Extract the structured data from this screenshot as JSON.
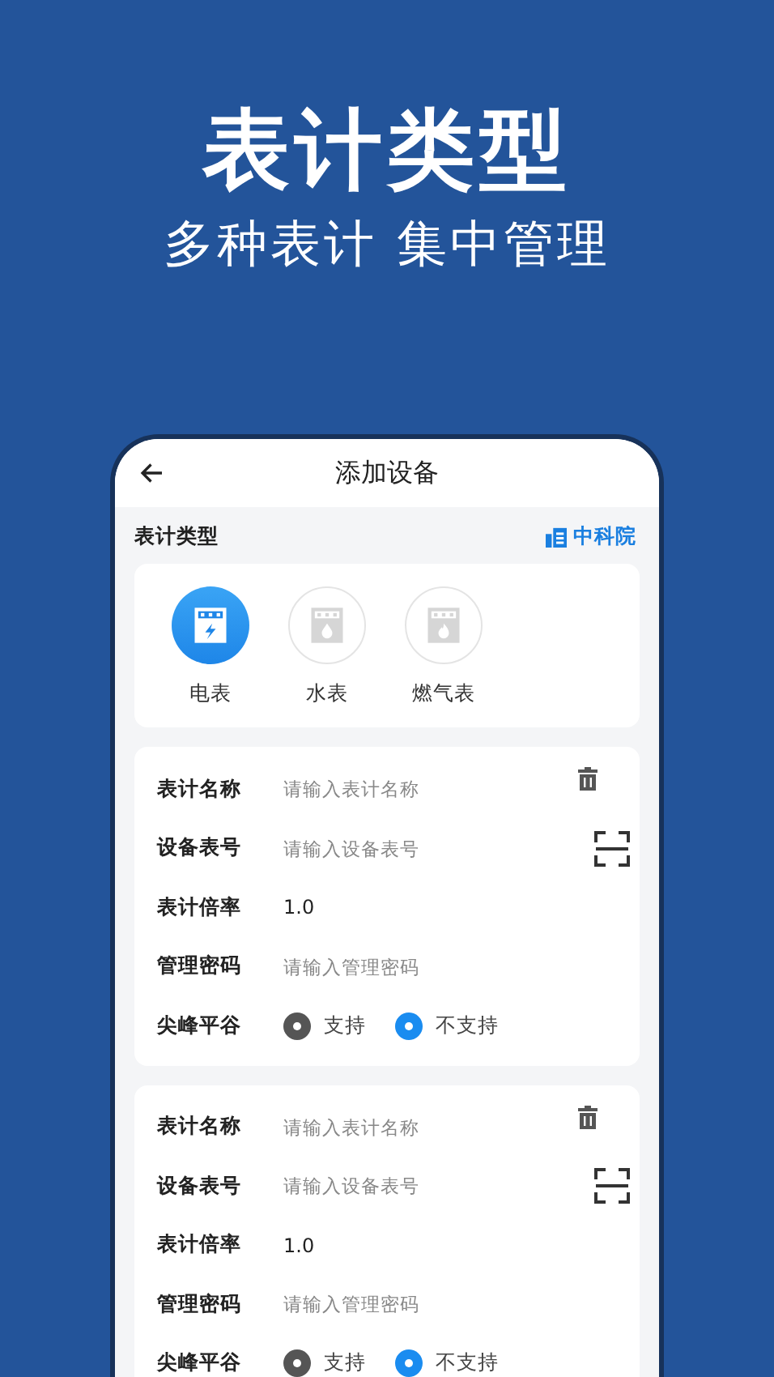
{
  "headline": "表计类型",
  "subheadline": "多种表计 集中管理",
  "app": {
    "title": "添加设备",
    "section_label": "表计类型",
    "org_link": "中科院",
    "meter_types": [
      {
        "label": "电表",
        "kind": "electric",
        "selected": true
      },
      {
        "label": "水表",
        "kind": "water",
        "selected": false
      },
      {
        "label": "燃气表",
        "kind": "gas",
        "selected": false
      }
    ],
    "meters": [
      {
        "fields": [
          {
            "kind": "input",
            "label": "表计名称",
            "placeholder": "请输入表计名称"
          },
          {
            "kind": "input",
            "label": "设备表号",
            "placeholder": "请输入设备表号",
            "scan": true
          },
          {
            "kind": "value",
            "label": "表计倍率",
            "value": "1.0"
          },
          {
            "kind": "input",
            "label": "管理密码",
            "placeholder": "请输入管理密码"
          },
          {
            "kind": "radio",
            "label": "尖峰平谷",
            "options": [
              {
                "label": "支持",
                "selected": false
              },
              {
                "label": "不支持",
                "selected": true
              }
            ]
          }
        ]
      },
      {
        "fields": [
          {
            "kind": "input",
            "label": "表计名称",
            "placeholder": "请输入表计名称"
          },
          {
            "kind": "input",
            "label": "设备表号",
            "placeholder": "请输入设备表号",
            "scan": true
          },
          {
            "kind": "value",
            "label": "表计倍率",
            "value": "1.0"
          },
          {
            "kind": "input",
            "label": "管理密码",
            "placeholder": "请输入管理密码"
          },
          {
            "kind": "radio",
            "label": "尖峰平谷",
            "options": [
              {
                "label": "支持",
                "selected": false
              },
              {
                "label": "不支持",
                "selected": true
              }
            ]
          }
        ]
      }
    ]
  }
}
